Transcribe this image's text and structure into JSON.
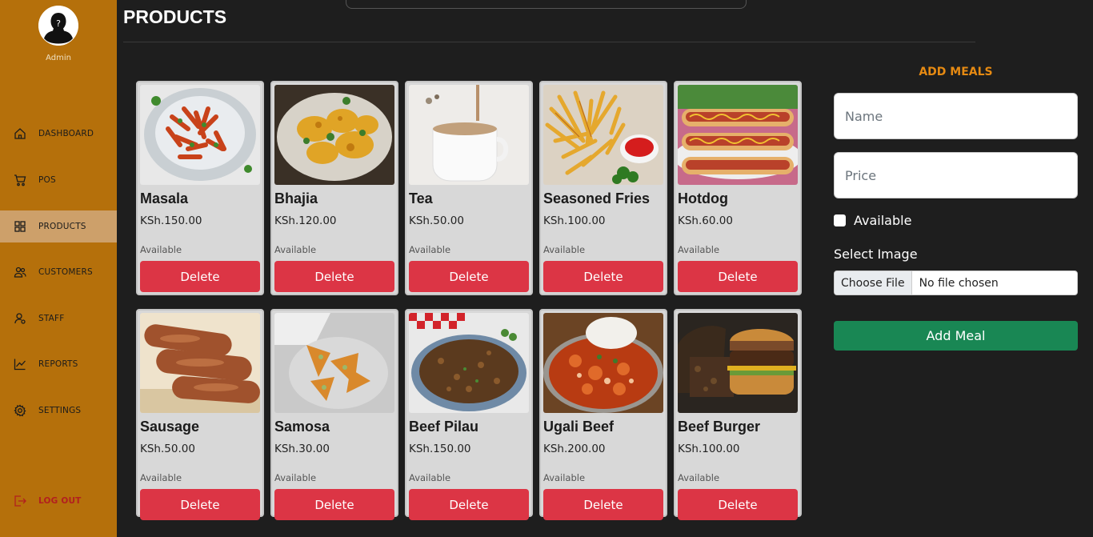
{
  "sidebar": {
    "user_label": "Admin",
    "items": [
      {
        "label": "DASHBOARD",
        "icon": "home-icon"
      },
      {
        "label": "POS",
        "icon": "cart-icon"
      },
      {
        "label": "PRODUCTS",
        "icon": "grid-icon",
        "active": true
      },
      {
        "label": "CUSTOMERS",
        "icon": "users-icon"
      },
      {
        "label": "STAFF",
        "icon": "staff-icon"
      },
      {
        "label": "REPORTS",
        "icon": "chart-icon"
      },
      {
        "label": "SETTINGS",
        "icon": "gear-icon"
      }
    ],
    "logout_label": "LOG OUT"
  },
  "header": {
    "title": "PRODUCTS"
  },
  "products": [
    {
      "name": "Masala",
      "price": "KSh.150.00",
      "status": "Available",
      "delete_label": "Delete"
    },
    {
      "name": "Bhajia",
      "price": "KSh.120.00",
      "status": "Available",
      "delete_label": "Delete"
    },
    {
      "name": "Tea",
      "price": "KSh.50.00",
      "status": "Available",
      "delete_label": "Delete"
    },
    {
      "name": "Seasoned Fries",
      "price": "KSh.100.00",
      "status": "Available",
      "delete_label": "Delete"
    },
    {
      "name": "Hotdog",
      "price": "KSh.60.00",
      "status": "Available",
      "delete_label": "Delete"
    },
    {
      "name": "Sausage",
      "price": "KSh.50.00",
      "status": "Available",
      "delete_label": "Delete"
    },
    {
      "name": "Samosa",
      "price": "KSh.30.00",
      "status": "Available",
      "delete_label": "Delete"
    },
    {
      "name": "Beef Pilau",
      "price": "KSh.150.00",
      "status": "Available",
      "delete_label": "Delete"
    },
    {
      "name": "Ugali Beef",
      "price": "KSh.200.00",
      "status": "Available",
      "delete_label": "Delete"
    },
    {
      "name": "Beef Burger",
      "price": "KSh.100.00",
      "status": "Available",
      "delete_label": "Delete"
    }
  ],
  "form": {
    "title": "ADD MEALS",
    "name_placeholder": "Name",
    "price_placeholder": "Price",
    "available_label": "Available",
    "select_image_label": "Select Image",
    "choose_file_label": "Choose File",
    "no_file_text": "No file chosen",
    "submit_label": "Add Meal"
  },
  "colors": {
    "sidebar": "#b5700b",
    "accent": "#e68a12",
    "delete": "#dc3545",
    "add": "#198754"
  }
}
